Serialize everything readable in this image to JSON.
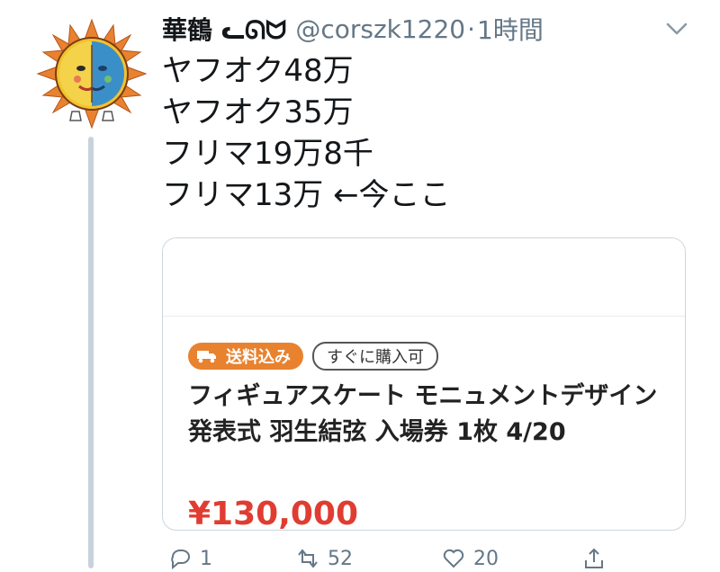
{
  "tweet": {
    "display_name": "華鶴 ᓚᘏᗢ",
    "handle": "@corszk1220",
    "separator": "·",
    "timestamp": "1時間",
    "menu_icon": "chevron-down-icon",
    "avatar_icon": "sun-moon-avatar",
    "lines": [
      "ヤフオク48万",
      "ヤフオク35万",
      "フリマ19万8千",
      "フリマ13万 ←今ここ"
    ]
  },
  "card": {
    "badge_shipping": "送料込み",
    "badge_shipping_icon": "truck-icon",
    "badge_buy": "すぐに購入可",
    "title": "フィギュアスケート モニュメントデザイン発表式 羽生結弦 入場券 1枚 4/20",
    "price": "¥130,000"
  },
  "actions": {
    "reply_icon": "reply-icon",
    "reply_count": "1",
    "retweet_icon": "retweet-icon",
    "retweet_count": "52",
    "like_icon": "heart-icon",
    "like_count": "20",
    "share_icon": "share-icon"
  },
  "colors": {
    "accent_orange": "#e8822f",
    "price_red": "#e03c31",
    "secondary_text": "#657786",
    "thread_line": "#c8d2dc"
  }
}
